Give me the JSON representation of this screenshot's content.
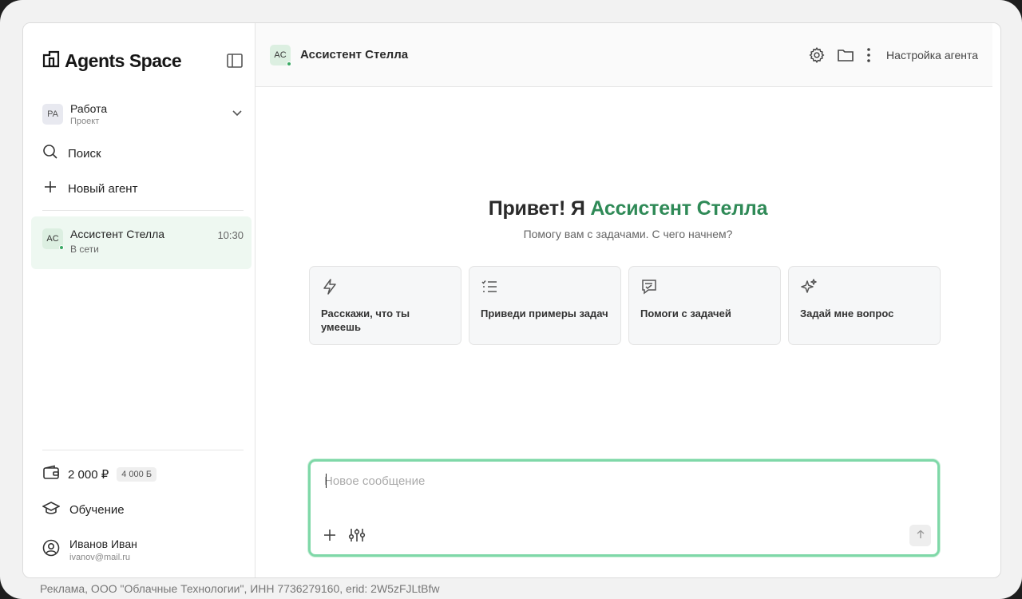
{
  "app": {
    "logo_text": "Agents Space"
  },
  "sidebar": {
    "project": {
      "badge": "PA",
      "name": "Работа",
      "subtitle": "Проект"
    },
    "search_label": "Поиск",
    "new_agent_label": "Новый агент",
    "chats": [
      {
        "avatar": "AC",
        "name": "Ассистент Стелла",
        "status": "В сети",
        "time": "10:30",
        "online": true
      }
    ],
    "balance": {
      "amount": "2 000 ₽",
      "bonus": "4 000 Б"
    },
    "learning_label": "Обучение",
    "user": {
      "name": "Иванов Иван",
      "email": "ivanov@mail.ru"
    }
  },
  "topbar": {
    "avatar": "AC",
    "title": "Ассистент Стелла",
    "agent_settings_label": "Настройка агента"
  },
  "hero": {
    "greeting_prefix": "Привет! Я ",
    "greeting_name": "Ассистент Стелла",
    "subtitle": "Помогу вам с задачами. С чего начнем?"
  },
  "cards": [
    {
      "icon": "lightning-icon",
      "label": "Расскажи, что ты умеешь"
    },
    {
      "icon": "list-check-icon",
      "label": "Приведи примеры задач"
    },
    {
      "icon": "message-check-icon",
      "label": "Помоги с задачей"
    },
    {
      "icon": "sparkle-icon",
      "label": "Задай мне вопрос"
    }
  ],
  "composer": {
    "placeholder": "Новое сообщение",
    "value": ""
  },
  "footer": {
    "ad_text": "Реклама, ООО \"Облачные Технологии\", ИНН 7736279160, erid: 2W5zFJLtBfw"
  },
  "colors": {
    "accent": "#2f8a57",
    "composer_border": "#7fd8a8",
    "chat_active_bg": "#eef8f1"
  }
}
